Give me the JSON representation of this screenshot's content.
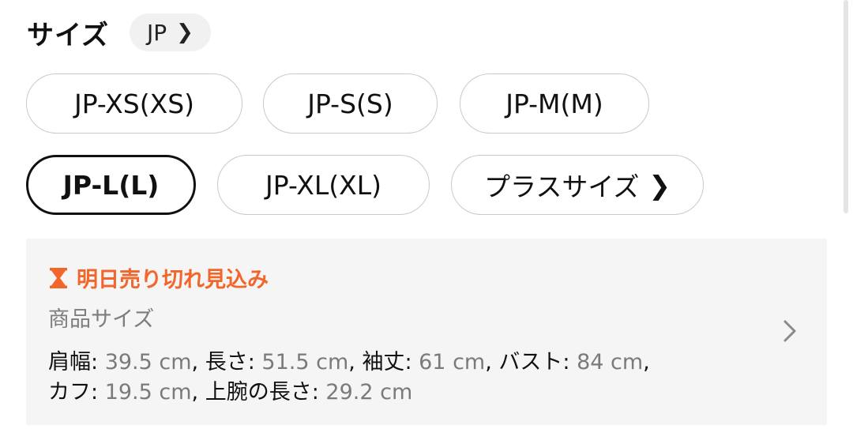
{
  "header": {
    "title": "サイズ",
    "region": "JP"
  },
  "sizes": [
    {
      "label": "JP-XS(XS)",
      "selected": false
    },
    {
      "label": "JP-S(S)",
      "selected": false
    },
    {
      "label": "JP-M(M)",
      "selected": false
    },
    {
      "label": "JP-L(L)",
      "selected": true
    },
    {
      "label": "JP-XL(XL)",
      "selected": false
    },
    {
      "label": "プラスサイズ",
      "selected": false
    }
  ],
  "info": {
    "warning": "明日売り切れ見込み",
    "label": "商品サイズ",
    "measurements": [
      {
        "name": "肩幅",
        "value": "39.5 cm"
      },
      {
        "name": "長さ",
        "value": "51.5 cm"
      },
      {
        "name": "袖丈",
        "value": "61 cm"
      },
      {
        "name": "バスト",
        "value": "84 cm"
      },
      {
        "name": "カフ",
        "value": "19.5 cm"
      },
      {
        "name": "上腕の長さ",
        "value": "29.2 cm"
      }
    ]
  },
  "icons": {
    "region_chevron": "chevron-right-icon",
    "plus_size_chevron": "chevron-right-icon",
    "warning": "hourglass-icon",
    "panel_chevron": "chevron-right-icon"
  },
  "colors": {
    "accent": "#f2662b",
    "selected_border": "#111111",
    "border": "#c9c9c9",
    "panel_bg": "#f5f5f5",
    "muted_text": "#7a7a7a"
  }
}
